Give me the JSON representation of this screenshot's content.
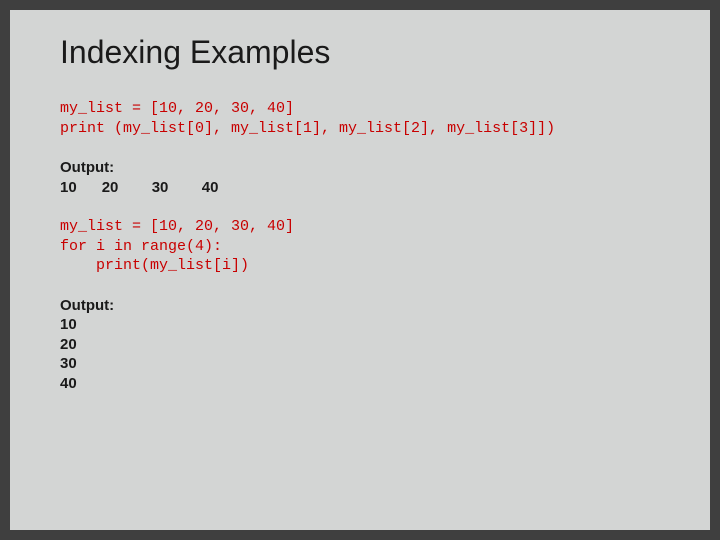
{
  "title": "Indexing Examples",
  "code1": "my_list = [10, 20, 30, 40]\nprint (my_list[0], my_list[1], my_list[2], my_list[3]])",
  "output1_label": "Output:",
  "output1_values": "10      20        30        40",
  "code2": "my_list = [10, 20, 30, 40]\nfor i in range(4):\n    print(my_list[i])",
  "output2_label": "Output:",
  "output2_values": "10\n20\n30\n40"
}
